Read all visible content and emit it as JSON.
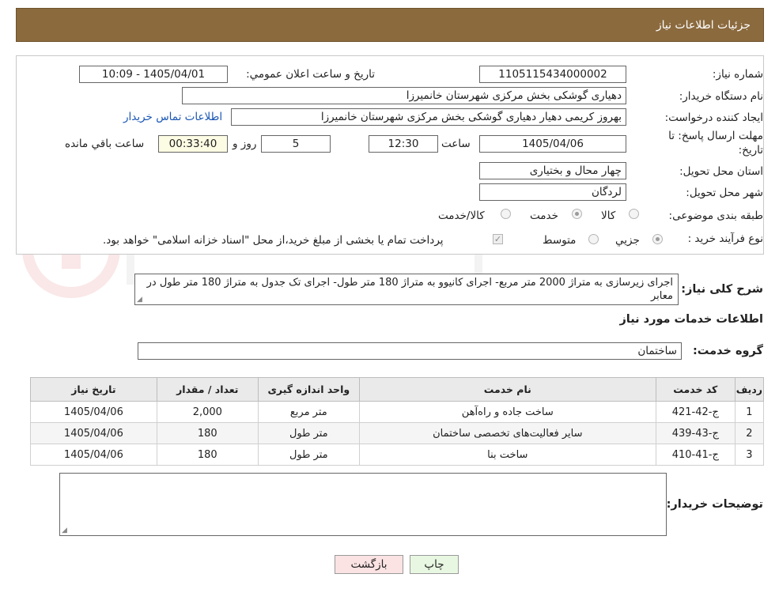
{
  "header": {
    "title": "جزئیات اطلاعات نیاز"
  },
  "form": {
    "need_number_label": "شماره نیاز:",
    "need_number": "1105115434000002",
    "announce_label": "تاریخ و ساعت اعلان عمومي:",
    "announce_value": "1405/04/01 - 10:09",
    "buyer_org_label": "نام دستگاه خريدار:",
    "buyer_org": "دهیاری گوشکی بخش مرکزی شهرستان خانمیرزا",
    "requester_label": "ايجاد كننده درخواست:",
    "requester": "بهروز کریمی دهیار دهیاری گوشکی بخش مرکزی شهرستان خانمیرزا",
    "contact_link": "اطلاعات تماس خريدار",
    "deadline_label_1": "مهلت ارسال پاسخ: تا",
    "deadline_label_2": "تاريخ:",
    "deadline_date": "1405/04/06",
    "time_label": "ساعت",
    "deadline_time": "12:30",
    "days_value": "5",
    "days_label": "روز و",
    "remaining_time": "00:33:40",
    "remaining_label": "ساعت باقي مانده",
    "province_label": "استان محل تحويل:",
    "province": "چهار محال و بختیاری",
    "city_label": "شهر محل تحويل:",
    "city": "لردگان",
    "category_label": "طبقه بندی موضوعی:",
    "category_options": [
      "کالا",
      "خدمت",
      "کالا/خدمت"
    ],
    "process_label": "نوع فرآيند خريد :",
    "process_options": [
      "جزيي",
      "متوسط"
    ],
    "payment_note": "پرداخت تمام يا بخشی از مبلغ خريد،از محل \"اسناد خزانه اسلامی\" خواهد بود."
  },
  "summary": {
    "label": "شرح کلی نیاز:",
    "text": "اجرای زیرسازی به متراژ 2000 متر مربع- اجرای کانیوو به متراژ 180 متر طول- اجرای تک جدول به متراژ 180 متر طول در معابر"
  },
  "services": {
    "title": "اطلاعات خدمات مورد نياز",
    "group_label": "گروه خدمت:",
    "group_value": "ساختمان",
    "columns": [
      "رديف",
      "کد خدمت",
      "نام خدمت",
      "واحد اندازه گيری",
      "تعداد / مقدار",
      "تاريخ نياز"
    ],
    "rows": [
      [
        "1",
        "ج-42-421",
        "ساخت جاده و راه‌آهن",
        "متر مربع",
        "2,000",
        "1405/04/06"
      ],
      [
        "2",
        "ج-43-439",
        "سایر فعالیت‌های تخصصی ساختمان",
        "متر طول",
        "180",
        "1405/04/06"
      ],
      [
        "3",
        "ج-41-410",
        "ساخت بنا",
        "متر طول",
        "180",
        "1405/04/06"
      ]
    ]
  },
  "buyer_notes": {
    "label": "توضيحات خريدار:",
    "value": ""
  },
  "buttons": {
    "print": "چاپ",
    "back": "بازگشت"
  },
  "colors": {
    "header_bg": "#8b6a3e",
    "print_btn": "#e8f7e1",
    "back_btn": "#fbe3e3"
  }
}
